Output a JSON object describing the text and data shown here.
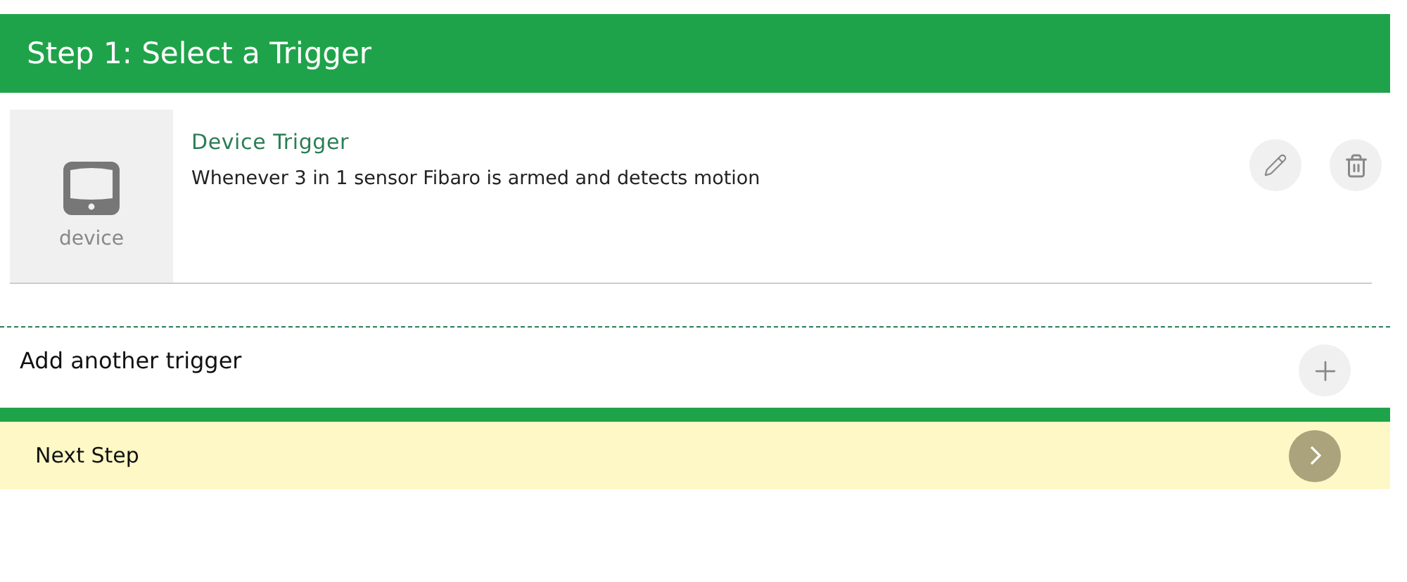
{
  "header": {
    "title": "Step 1: Select a Trigger"
  },
  "triggers": [
    {
      "icon_label": "device",
      "title": "Device Trigger",
      "description": "Whenever 3 in 1 sensor Fibaro is armed and detects motion"
    }
  ],
  "add_trigger": {
    "label": "Add another trigger"
  },
  "next_step": {
    "label": "Next Step"
  }
}
